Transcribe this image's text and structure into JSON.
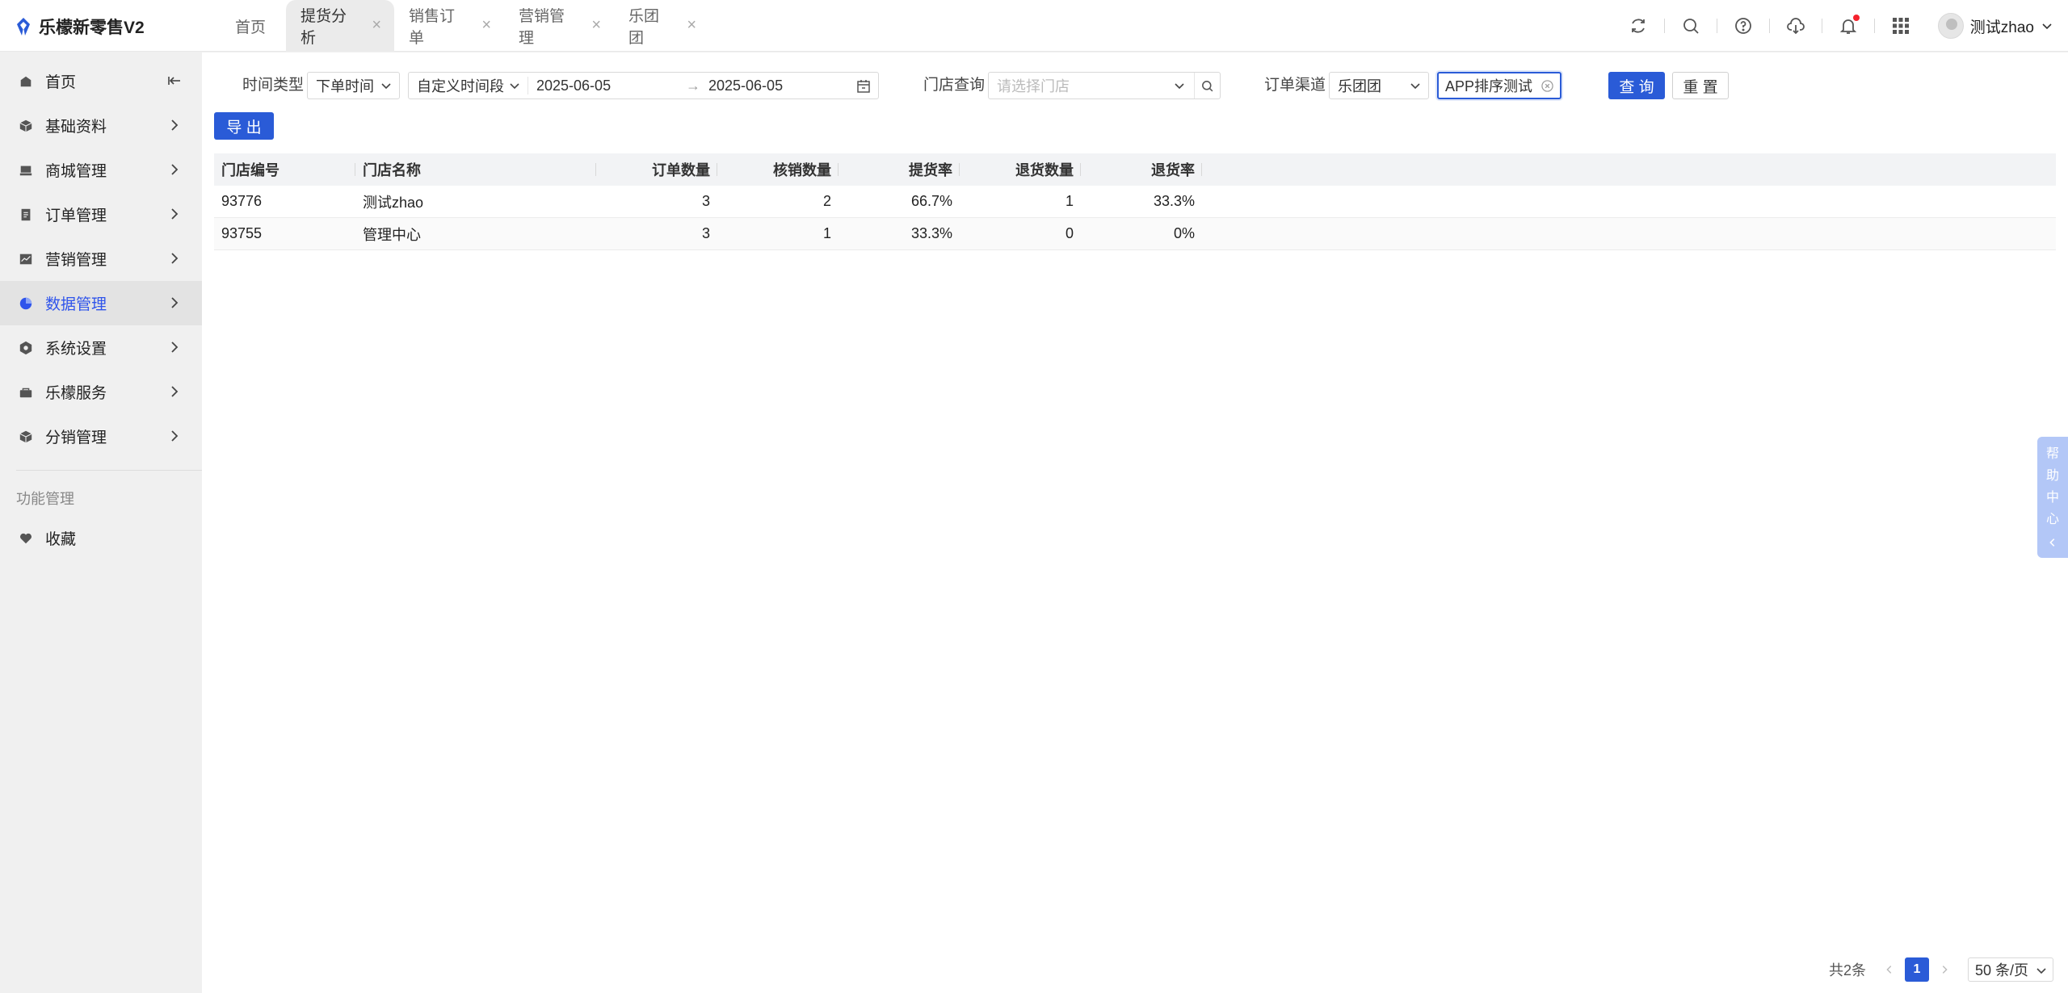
{
  "app": {
    "title": "乐檬新零售V2"
  },
  "tabs": [
    {
      "label": "首页",
      "active": false,
      "closable": false
    },
    {
      "label": "提货分析",
      "active": true,
      "closable": true
    },
    {
      "label": "销售订单",
      "active": false,
      "closable": true
    },
    {
      "label": "营销管理",
      "active": false,
      "closable": true
    },
    {
      "label": "乐团团",
      "active": false,
      "closable": true
    }
  ],
  "user": {
    "name": "测试zhao"
  },
  "sidebar": {
    "items": [
      {
        "label": "首页",
        "icon": "home-icon"
      },
      {
        "label": "基础资料",
        "icon": "cube-icon"
      },
      {
        "label": "商城管理",
        "icon": "store-icon"
      },
      {
        "label": "订单管理",
        "icon": "order-icon"
      },
      {
        "label": "营销管理",
        "icon": "chart-icon"
      },
      {
        "label": "数据管理",
        "icon": "pie-icon"
      },
      {
        "label": "系统设置",
        "icon": "hexagon-icon"
      },
      {
        "label": "乐檬服务",
        "icon": "service-icon"
      },
      {
        "label": "分销管理",
        "icon": "distribution-icon"
      }
    ],
    "group_label": "功能管理",
    "favorites_label": "收藏"
  },
  "filters": {
    "time_type_label": "时间类型",
    "time_type_value": "下单时间",
    "range_type_value": "自定义时间段",
    "start_date": "2025-06-05",
    "end_date": "2025-06-05",
    "range_sep": "→",
    "store_label": "门店查询",
    "store_placeholder": "请选择门店",
    "channel_label": "订单渠道",
    "channel_value": "乐团团",
    "group_value": "APP排序测试",
    "query_label": "查 询",
    "reset_label": "重 置",
    "export_label": "导 出"
  },
  "table": {
    "columns": [
      "门店编号",
      "门店名称",
      "订单数量",
      "核销数量",
      "提货率",
      "退货数量",
      "退货率"
    ],
    "rows": [
      [
        "93776",
        "测试zhao",
        "3",
        "2",
        "66.7%",
        "1",
        "33.3%"
      ],
      [
        "93755",
        "管理中心",
        "3",
        "1",
        "33.3%",
        "0",
        "0%"
      ]
    ]
  },
  "pagination": {
    "total_text": "共2条",
    "current": "1",
    "page_size": "50 条/页"
  },
  "help": {
    "chars": [
      "帮",
      "助",
      "中",
      "心"
    ]
  },
  "colors": {
    "primary": "#2a5bd7",
    "active_menu": "#2f54eb",
    "notify_dot": "#f5222d"
  }
}
